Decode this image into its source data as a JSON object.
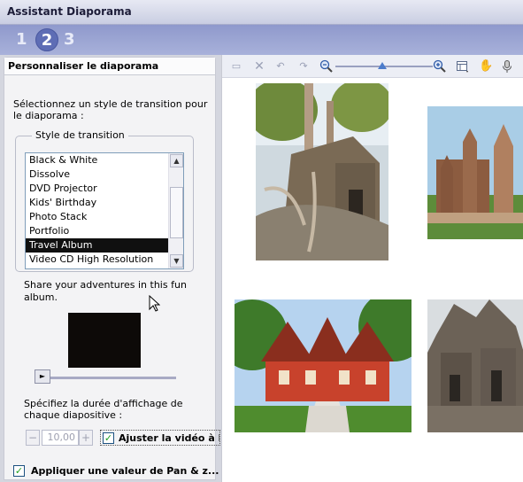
{
  "window": {
    "title": "Assistant Diaporama"
  },
  "steps": [
    "1",
    "2",
    "3"
  ],
  "current_step": 2,
  "left_panel": {
    "header": "Personnaliser le diaporama",
    "instruction": "Sélectionnez un style de transition pour le diaporama :",
    "group_label": "Style de transition",
    "styles": [
      "Black & White",
      "Dissolve",
      "DVD Projector",
      "Kids' Birthday",
      "Photo Stack",
      "Portfolio",
      "Travel Album",
      "Video CD High Resolution"
    ],
    "selected_style": "Travel Album",
    "style_description": "Share your adventures in this fun album.",
    "duration_label": "Spécifiez la durée d'affichage de chaque diapositive :",
    "duration_value": "10,00",
    "fit_video_label": "Ajuster la vidéo à l'a",
    "pan_zoom_label": "Appliquer une valeur de Pan & z..."
  },
  "colors": {
    "accent": "#5e6db5",
    "selection": "#101010",
    "check": "#21a121"
  },
  "toolbar_icons": [
    "monitor-icon",
    "delete-icon",
    "rotate-left-icon",
    "rotate-right-icon",
    "zoom-out-icon",
    "zoom-slider",
    "zoom-in-icon",
    "layout-icon",
    "hand-icon",
    "microphone-icon"
  ],
  "photos": [
    "temple-tree-roots",
    "stupa-ruins",
    "red-wooden-house",
    "stone-temple"
  ]
}
